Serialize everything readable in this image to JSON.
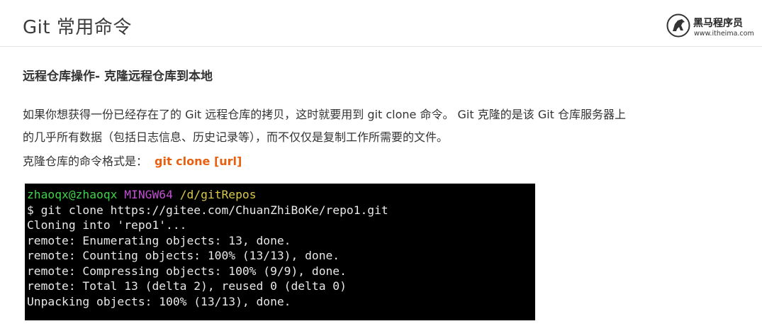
{
  "header": {
    "title": "Git 常用命令",
    "logo_name": "黑马程序员",
    "logo_url": "www.itheima.com"
  },
  "section": {
    "heading": "远程仓库操作- 克隆远程仓库到本地",
    "paragraph_line1": "如果你想获得一份已经存在了的 Git 远程仓库的拷贝，这时就要用到 git clone 命令。 Git 克隆的是该 Git 仓库服务器上",
    "paragraph_line2": "的几乎所有数据（包括日志信息、历史记录等），而不仅仅是复制工作所需要的文件。",
    "format_label": "克隆仓库的命令格式是：",
    "format_command": "git clone [url]"
  },
  "terminal": {
    "prompt_user": "zhaoqx@zhaoqx",
    "prompt_env": "MINGW64",
    "prompt_path": "/d/gitRepos",
    "command": "$ git clone https://gitee.com/ChuanZhiBoKe/repo1.git",
    "output": [
      "Cloning into 'repo1'...",
      "remote: Enumerating objects: 13, done.",
      "remote: Counting objects: 100% (13/13), done.",
      "remote: Compressing objects: 100% (9/9), done.",
      "remote: Total 13 (delta 2), reused 0 (delta 0)",
      "Unpacking objects: 100% (13/13), done."
    ]
  },
  "colors": {
    "accent": "#e8600e",
    "terminal_bg": "#000000",
    "prompt_user": "#3fd14a",
    "prompt_env": "#c24fd3",
    "prompt_path": "#d8c84a"
  }
}
